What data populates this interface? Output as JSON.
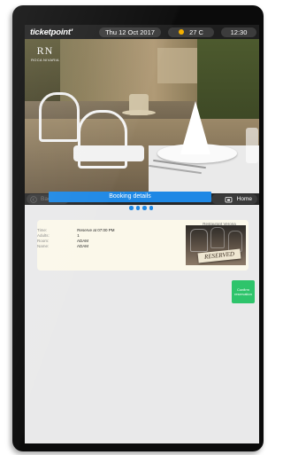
{
  "topbar": {
    "brand": "ticketpoint'",
    "date": "Thu 12 Oct 2017",
    "temperature": "27 C",
    "time": "12:30",
    "weather_icon": "sun-icon"
  },
  "hotel": {
    "monogram": "RN",
    "name": "ROCA NIVARIA"
  },
  "nav": {
    "back_label": "Back",
    "home_label": "Home"
  },
  "booking": {
    "title": "Booking details",
    "steps": 4,
    "restaurant": "Restaurant Verona",
    "sign_text": "RESERVED",
    "details": [
      {
        "label": "Time:",
        "value": "Reserve at 07:00 PM"
      },
      {
        "label": "Adults:",
        "value": "1"
      },
      {
        "label": "Room:",
        "value": "ADAM"
      },
      {
        "label": "Name:",
        "value": "ADAM"
      }
    ],
    "confirm_line1": "Confirm",
    "confirm_line2": "reservation"
  },
  "colors": {
    "accent": "#1e88e5",
    "confirm": "#2ec46b",
    "card": "#fbf8ea"
  }
}
